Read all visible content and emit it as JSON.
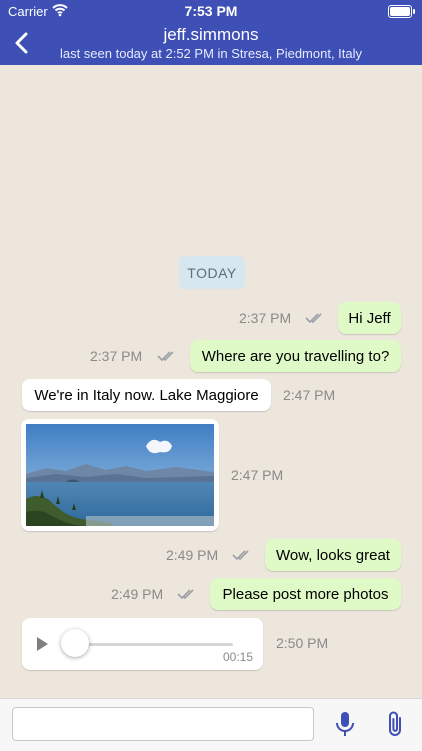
{
  "status_bar": {
    "carrier": "Carrier",
    "time": "7:53 PM"
  },
  "header": {
    "contact_name": "jeff.simmons",
    "last_seen": "last seen today at 2:52 PM in Stresa, Piedmont, Italy"
  },
  "chat": {
    "date_label": "TODAY",
    "messages": [
      {
        "direction": "outgoing",
        "text": "Hi Jeff",
        "time": "2:37 PM",
        "status": "read"
      },
      {
        "direction": "outgoing",
        "text": "Where are you travelling to?",
        "time": "2:37 PM",
        "status": "read"
      },
      {
        "direction": "incoming",
        "text": "We're in Italy now. Lake Maggiore",
        "time": "2:47 PM"
      },
      {
        "direction": "incoming",
        "type": "photo",
        "time": "2:47 PM"
      },
      {
        "direction": "outgoing",
        "text": "Wow, looks great",
        "time": "2:49 PM",
        "status": "read"
      },
      {
        "direction": "outgoing",
        "text": "Please post more photos",
        "time": "2:49 PM",
        "status": "read"
      },
      {
        "direction": "incoming",
        "type": "audio",
        "duration": "00:15",
        "progress": 0,
        "time": "2:50 PM"
      }
    ]
  },
  "composer": {
    "placeholder": ""
  },
  "icons": {
    "back": "chevron-left-icon",
    "wifi": "wifi-icon",
    "battery": "battery-icon",
    "read_ticks": "double-check-icon",
    "play": "play-icon",
    "mic": "microphone-icon",
    "attach": "paperclip-icon"
  },
  "colors": {
    "header": "#3e4fb5",
    "chat_background": "#ede6dc",
    "outgoing_bubble": "#dff9c7",
    "incoming_bubble": "#ffffff",
    "date_pill": "#d7e7ef",
    "accent_icon": "#3e4fb5"
  }
}
